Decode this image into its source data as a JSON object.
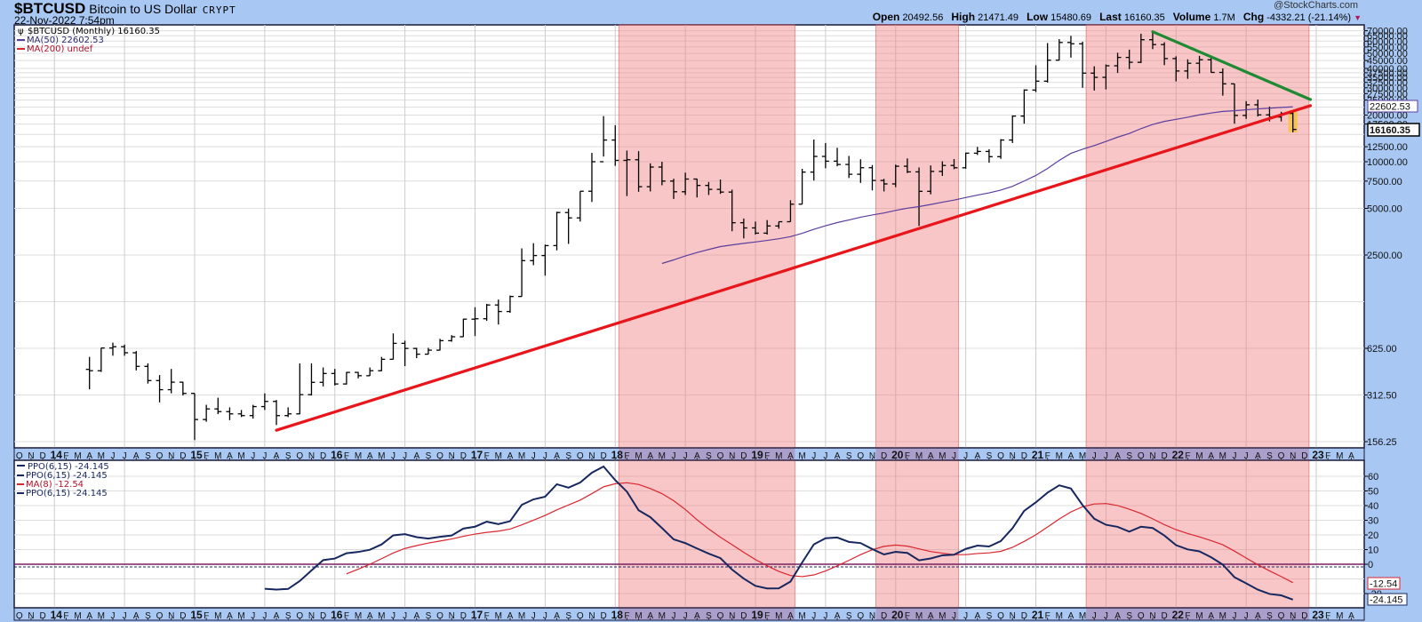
{
  "header": {
    "symbol": "$BTCUSD",
    "name": "Bitcoin to US Dollar",
    "exchange": "CRYPT",
    "datetime": "22-Nov-2022 7:54pm",
    "copyright": "@StockCharts.com",
    "open_label": "Open",
    "open": "20492.56",
    "high_label": "High",
    "high": "21471.49",
    "low_label": "Low",
    "low": "15480.69",
    "last_label": "Last",
    "last": "16160.35",
    "volume_label": "Volume",
    "volume": "1.7M",
    "chg_label": "Chg",
    "chg": "-4332.21 (-21.14%)",
    "chg_icon": "triangle-down-icon"
  },
  "legend_top": {
    "price": "$BTCUSD (Monthly) 16160.35",
    "ma50": "MA(50) 22602.53",
    "ma200": "MA(200) undef"
  },
  "legend_bottom": {
    "ppo1": "PPO(6,15) -24.145",
    "ppo2": "PPO(6,15) -24.145",
    "ma8": "MA(8) -12.54",
    "ppo3": "PPO(6,15) -24.145"
  },
  "price_tags": {
    "ma50": "22602.53",
    "last": "16160.35"
  },
  "ppo_tags": {
    "ma8": "-12.54",
    "ppo": "-24.145"
  },
  "colors": {
    "background": "#A8C8F3",
    "ma50": "#5A3E9E",
    "support_line": "#E8151B",
    "resistance_line": "#1E8A33",
    "shade": "#F08080",
    "ppo": "#17275F",
    "ma8": "#D8262F",
    "highlight": "#F5C342"
  },
  "chart_data": [
    {
      "type": "ohlc",
      "title": "$BTCUSD Bitcoin to US Dollar (Monthly)",
      "scale": "log",
      "first_month": "Apr 2014",
      "first_open": 457,
      "close": [
        448,
        628,
        640,
        585,
        478,
        387,
        338,
        378,
        320,
        217,
        254,
        244,
        236,
        230,
        263,
        284,
        230,
        236,
        314,
        377,
        430,
        368,
        437,
        416,
        448,
        531,
        673,
        624,
        573,
        608,
        700,
        742,
        964,
        970,
        1190,
        1080,
        1350,
        2300,
        2480,
        2875,
        4700,
        4340,
        6450,
        10000,
        13800,
        10200,
        10300,
        6900,
        9240,
        7500,
        6400,
        7730,
        7030,
        6630,
        6370,
        4040,
        3740,
        3460,
        3850,
        4100,
        5320,
        8570,
        10820,
        10080,
        9600,
        8300,
        9150,
        7570,
        7190,
        9350,
        8600,
        6440,
        8660,
        9460,
        9140,
        11350,
        11650,
        10780,
        13800,
        19700,
        29000,
        33100,
        45200,
        58800,
        57700,
        37300,
        35040,
        41600,
        47100,
        43800,
        61300,
        57000,
        46300,
        38500,
        43200,
        45500,
        37700,
        31800,
        19900,
        23300,
        20050,
        19430,
        20492.56,
        16160.35
      ],
      "high": [
        550,
        630,
        680,
        660,
        600,
        500,
        420,
        460,
        380,
        320,
        270,
        300,
        260,
        250,
        270,
        320,
        290,
        260,
        500,
        500,
        470,
        460,
        440,
        440,
        470,
        550,
        780,
        700,
        630,
        630,
        720,
        760,
        970,
        1150,
        1210,
        1290,
        1370,
        2760,
        2980,
        2920,
        4760,
        4980,
        6450,
        11400,
        19700,
        17200,
        11800,
        11700,
        9760,
        9990,
        7770,
        8500,
        7760,
        7400,
        7680,
        6600,
        4300,
        4110,
        4200,
        4100,
        5640,
        9000,
        13900,
        13200,
        12300,
        10900,
        10370,
        9520,
        7750,
        9580,
        10500,
        9180,
        9460,
        10060,
        10400,
        11450,
        12470,
        12050,
        14000,
        19900,
        29300,
        41900,
        58300,
        61800,
        64900,
        59500,
        41300,
        42400,
        50500,
        52900,
        67000,
        69000,
        59000,
        47900,
        45800,
        48200,
        47400,
        40000,
        31900,
        24600,
        25200,
        22700,
        21000,
        21471.49
      ],
      "low": [
        340,
        440,
        560,
        560,
        450,
        370,
        280,
        320,
        310,
        160,
        210,
        235,
        215,
        225,
        220,
        250,
        200,
        225,
        235,
        310,
        355,
        360,
        365,
        400,
        415,
        445,
        530,
        480,
        540,
        570,
        605,
        690,
        740,
        750,
        940,
        890,
        1060,
        1350,
        2150,
        1840,
        2680,
        2950,
        4110,
        5500,
        10800,
        9400,
        6000,
        6400,
        6430,
        7050,
        5750,
        6100,
        5880,
        6100,
        6200,
        3560,
        3200,
        3390,
        3390,
        3700,
        4100,
        5320,
        7560,
        9070,
        9340,
        7850,
        7300,
        6530,
        6430,
        6850,
        8450,
        3850,
        6160,
        8100,
        8950,
        9010,
        11060,
        9850,
        10430,
        13200,
        17600,
        28100,
        32400,
        45000,
        47000,
        30000,
        28800,
        29300,
        37400,
        39600,
        43300,
        53300,
        42000,
        33000,
        34300,
        37200,
        37600,
        26700,
        17600,
        18900,
        19600,
        18200,
        18200,
        15480.69
      ],
      "overlays": {
        "ma_period": 50
      },
      "y_ticks": [
        "156.25",
        "312.50",
        "625.00",
        "2500.00",
        "5000.00",
        "7500.00",
        "10000.00",
        "12500.00",
        "17500.00",
        "20000.00",
        "25000.00",
        "27500.00",
        "30000.00",
        "32500.00",
        "35000.00",
        "37500.00",
        "40000.00",
        "45000.00",
        "50000.00",
        "55000.00",
        "60000.00",
        "65000.00",
        "70000.00"
      ],
      "grid_values": [
        156.25,
        312.5,
        625,
        1250,
        2500,
        5000,
        7500,
        10000,
        12500,
        15000,
        17500,
        20000,
        22500,
        25000,
        27500,
        30000,
        32500,
        35000,
        37500,
        40000,
        45000,
        50000,
        55000,
        60000,
        65000,
        70000
      ],
      "trendlines": [
        {
          "name": "support-trendline",
          "color": "support_line",
          "from": [
            "Aug 2015",
            185
          ],
          "to": [
            "mid Dec 2022",
            23000
          ]
        },
        {
          "name": "resistance-trendline",
          "color": "resistance_line",
          "from": [
            "Nov 2021",
            69000
          ],
          "to": [
            "mid Dec 2022",
            25200
          ]
        }
      ],
      "shaded_periods": [
        {
          "start": "Jan 2018",
          "end": "Apr 2019"
        },
        {
          "start": "Nov 2019",
          "end": "Jun 2020"
        },
        {
          "start": "May 2021",
          "end": "Dec 2022"
        }
      ],
      "highlight": {
        "month": "Nov 2022",
        "from": 15480.69,
        "to": 21471.49
      }
    },
    {
      "type": "line",
      "title": "PPO(6,15) with MA(8)",
      "fast": 6,
      "slow": 15,
      "signal_ma": 8,
      "ylim": [
        -25,
        68
      ],
      "y_ticks": [
        "60",
        "50",
        "40",
        "30",
        "20",
        "10",
        "0",
        "-20"
      ],
      "grid_values": [
        -20,
        -10,
        0,
        10,
        20,
        30,
        40,
        50,
        60
      ]
    }
  ],
  "x_axis": {
    "first_month": "Oct 2013",
    "labels": [
      "O",
      "N",
      "D",
      "14",
      "F",
      "M",
      "A",
      "M",
      "J",
      "J",
      "A",
      "S",
      "O",
      "N",
      "D",
      "15",
      "F",
      "M",
      "A",
      "M",
      "J",
      "J",
      "A",
      "S",
      "O",
      "N",
      "D",
      "16",
      "F",
      "M",
      "A",
      "M",
      "J",
      "J",
      "A",
      "S",
      "O",
      "N",
      "D",
      "17",
      "F",
      "M",
      "A",
      "M",
      "J",
      "J",
      "A",
      "S",
      "O",
      "N",
      "D",
      "18",
      "F",
      "M",
      "A",
      "M",
      "J",
      "J",
      "A",
      "S",
      "O",
      "N",
      "D",
      "19",
      "F",
      "M",
      "A",
      "M",
      "J",
      "J",
      "A",
      "S",
      "O",
      "N",
      "D",
      "20",
      "F",
      "M",
      "A",
      "M",
      "J",
      "J",
      "A",
      "S",
      "O",
      "N",
      "D",
      "21",
      "F",
      "M",
      "A",
      "M",
      "J",
      "J",
      "A",
      "S",
      "O",
      "N",
      "D",
      "22",
      "F",
      "M",
      "A",
      "M",
      "J",
      "J",
      "A",
      "S",
      "O",
      "N",
      "D",
      "23",
      "F",
      "M",
      "A"
    ]
  }
}
